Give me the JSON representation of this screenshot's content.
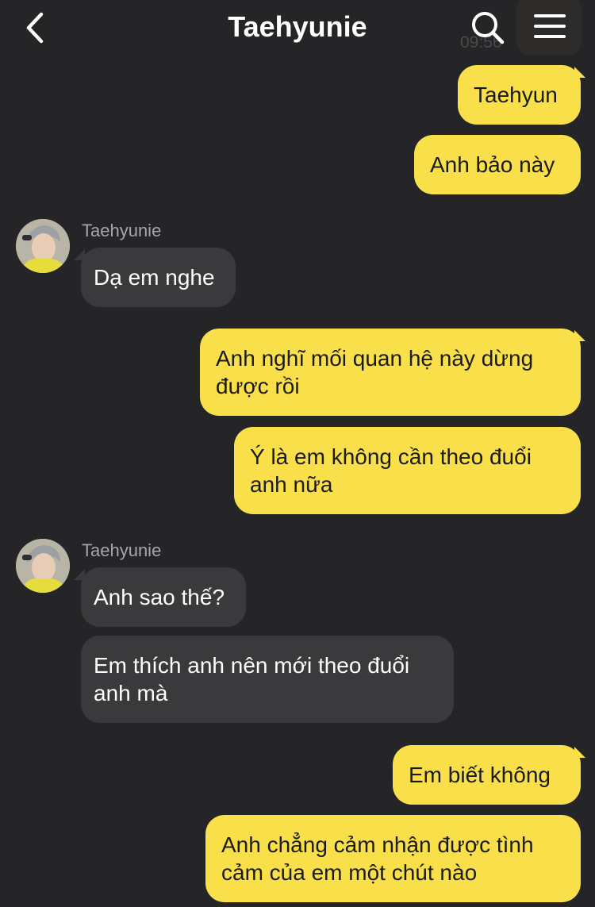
{
  "header": {
    "title": "Taehyunie",
    "timestamp": "09:56",
    "icons": {
      "back": "chevron-left-icon",
      "search": "search-icon",
      "menu": "hamburger-menu-icon"
    }
  },
  "colors": {
    "background": "#252527",
    "my_bubble": "#f9e04b",
    "their_bubble": "#3a393c",
    "sender_name": "#a7a7aa"
  },
  "messages": [
    {
      "from": "me",
      "lines": [
        "Taehyun"
      ]
    },
    {
      "from": "me",
      "lines": [
        "Anh bảo này"
      ]
    },
    {
      "from": "them",
      "sender": "Taehyunie",
      "lines": [
        "Dạ em nghe"
      ]
    },
    {
      "from": "me",
      "lines": [
        "Anh nghĩ mối quan hệ này dừng",
        "được rồi"
      ]
    },
    {
      "from": "me",
      "lines": [
        "Ý là em không cần theo đuổi",
        "anh nữa"
      ]
    },
    {
      "from": "them",
      "sender": "Taehyunie",
      "lines": [
        "Anh sao thế?"
      ]
    },
    {
      "from": "them",
      "lines": [
        "Em thích anh nên mới theo đuổi",
        "anh mà"
      ]
    },
    {
      "from": "me",
      "lines": [
        "Em biết không"
      ]
    },
    {
      "from": "me",
      "lines": [
        "Anh chẳng cảm nhận được tình",
        "cảm của em một chút nào"
      ]
    }
  ]
}
